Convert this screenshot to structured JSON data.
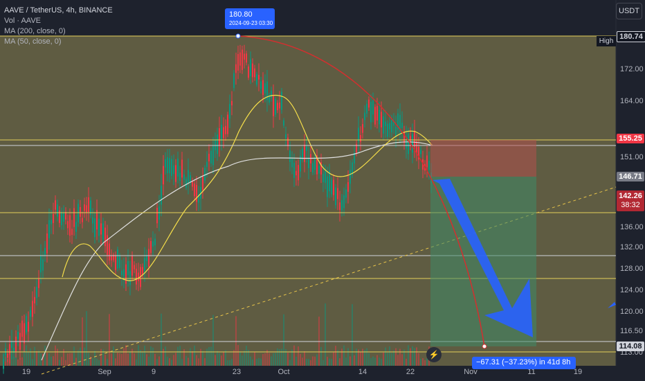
{
  "legend": {
    "title": "AAVE / TetherUS, 4h, BINANCE",
    "volume": "Vol · AAVE",
    "ma200": "MA (200, close, 0)",
    "ma50": "MA (50, close, 0)"
  },
  "currency": "USDT",
  "high_tag": "High",
  "price_axis": [
    "172.00",
    "164.00",
    "151.00",
    "136.00",
    "132.00",
    "128.00",
    "124.00",
    "120.00",
    "116.50",
    "113.00"
  ],
  "badges": {
    "high": "180.74",
    "red_level": "155.25",
    "gray_level": "146.71",
    "current_price": "142.26",
    "countdown": "38:32",
    "target": "114.08"
  },
  "time_axis": [
    "19",
    "Sep",
    "9",
    "23",
    "Oct",
    "14",
    "22",
    "Nov",
    "11",
    "19"
  ],
  "callout": {
    "value": "180.80",
    "datetime": "2024-09-23 03:30"
  },
  "measure": "−67.31 (−37.23%) in 41d 8h",
  "colors": {
    "bg": "#1e222d",
    "up": "#089981",
    "down": "#f23645",
    "ma50": "#f7e04b",
    "ma200": "#e0e0e0",
    "accent": "#2962ff"
  },
  "icons": {
    "replay": "lightning-icon"
  }
}
